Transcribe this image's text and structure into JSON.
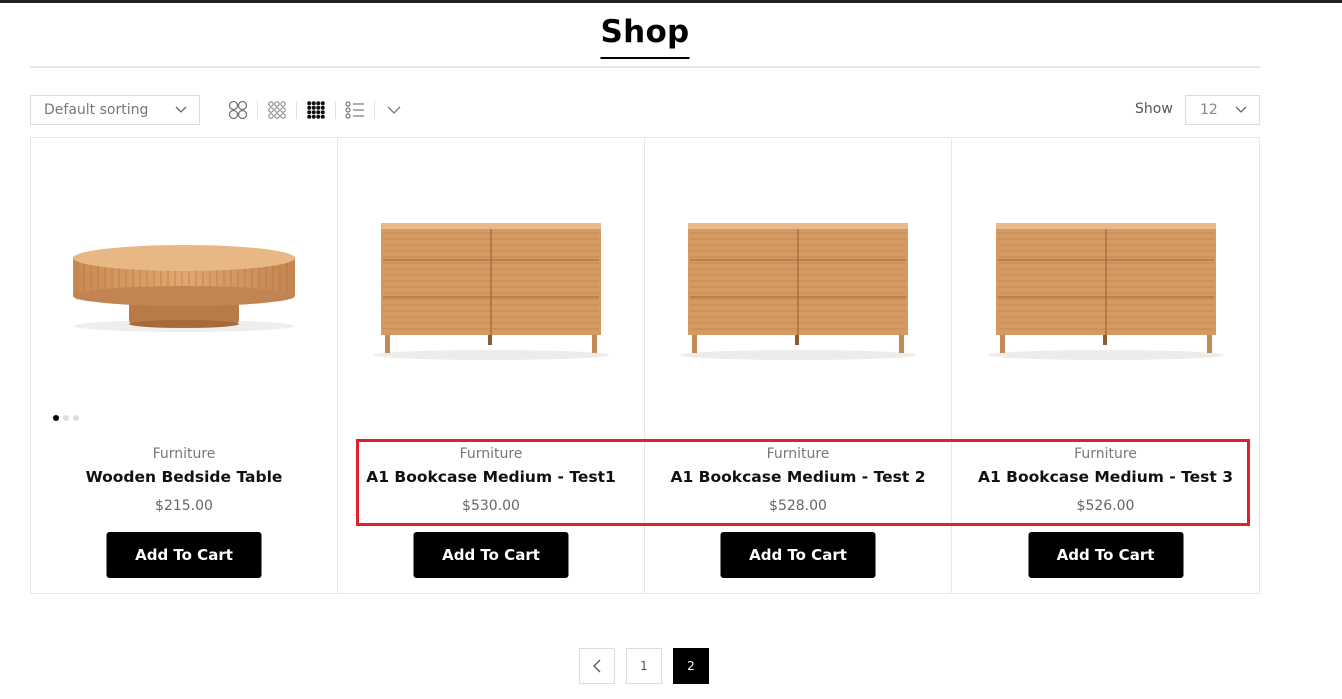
{
  "page": {
    "title": "Shop"
  },
  "toolbar": {
    "sorting": {
      "value": "Default sorting"
    },
    "view_icons": [
      "grid-2-icon",
      "grid-3-icon",
      "grid-4-icon",
      "list-icon",
      "chevron-down-icon"
    ],
    "active_view": "grid-4-icon",
    "show_label": "Show",
    "show_value": "12"
  },
  "products": [
    {
      "category": "Furniture",
      "name": "Wooden Bedside Table",
      "price": "$215.00",
      "button": "Add To Cart",
      "image": "round-wooden-table"
    },
    {
      "category": "Furniture",
      "name": "A1 Bookcase Medium - Test1",
      "price": "$530.00",
      "button": "Add To Cart",
      "image": "wooden-sideboard"
    },
    {
      "category": "Furniture",
      "name": "A1 Bookcase Medium - Test 2",
      "price": "$528.00",
      "button": "Add To Cart",
      "image": "wooden-sideboard"
    },
    {
      "category": "Furniture",
      "name": "A1 Bookcase Medium - Test 3",
      "price": "$526.00",
      "button": "Add To Cart",
      "image": "wooden-sideboard"
    }
  ],
  "pagination": {
    "pages": [
      "1",
      "2"
    ],
    "current": "2"
  },
  "colors": {
    "accent": "#000000",
    "highlight": "#e0202a",
    "wood": "#d49a62"
  }
}
